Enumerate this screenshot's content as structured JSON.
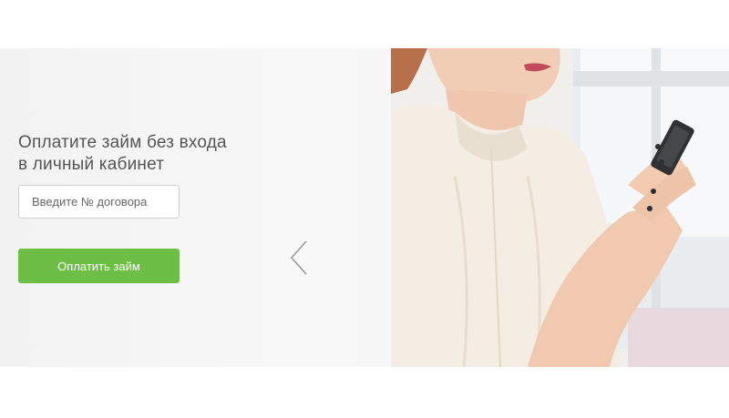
{
  "banner": {
    "headline_line1": "Оплатите займ без входа",
    "headline_line2": "в личный кабинет",
    "contract_input": {
      "placeholder": "Введите № договора",
      "value": ""
    },
    "pay_button_label": "Оплатить займ",
    "icons": {
      "prev": "chevron-left-icon"
    },
    "colors": {
      "accent_green": "#6cbe45",
      "headline_text": "#555555",
      "banner_bg": "#f4f4f4"
    }
  }
}
